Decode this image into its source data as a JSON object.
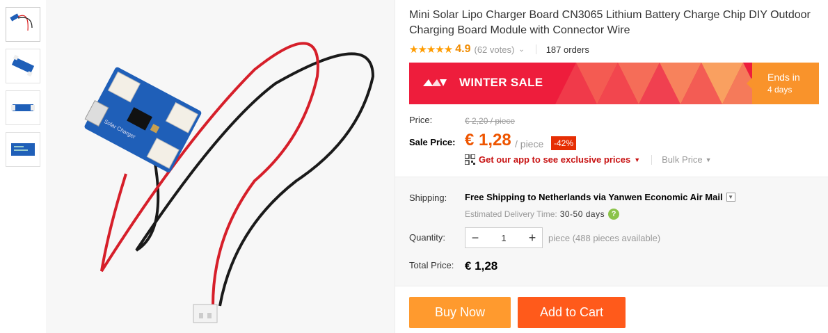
{
  "product": {
    "title": "Mini Solar Lipo Charger Board CN3065 Lithium Battery Charge Chip DIY Outdoor Charging Board Module with Connector Wire",
    "rating_stars": "★★★★★",
    "rating_value": "4.9",
    "votes": "(62 votes)",
    "orders": "187 orders"
  },
  "banner": {
    "text": "WINTER SALE",
    "ends_label": "Ends in",
    "ends_days": "4 days"
  },
  "price": {
    "label": "Price:",
    "old_price": "€ 2,20 / piece",
    "sale_label": "Sale Price:",
    "sale_price": "€ 1,28",
    "per_piece": "/ piece",
    "discount": "-42%",
    "app_link": "Get our app to see exclusive prices",
    "bulk_price": "Bulk Price"
  },
  "shipping": {
    "label": "Shipping:",
    "text": "Free Shipping to Netherlands via Yanwen Economic Air Mail",
    "est_label": "Estimated Delivery Time:",
    "est_days": "30-50 days"
  },
  "quantity": {
    "label": "Quantity:",
    "value": "1",
    "available": "piece (488 pieces available)"
  },
  "total": {
    "label": "Total Price:",
    "value": "€ 1,28"
  },
  "actions": {
    "buy_now": "Buy Now",
    "add_to_cart": "Add to Cart"
  },
  "colors": {
    "accent_orange": "#ff9a2e",
    "cart_orange": "#ff5a1b",
    "sale_red": "#ee1d3c",
    "price_orange": "#ee5500",
    "board_blue": "#1f5fb8"
  }
}
